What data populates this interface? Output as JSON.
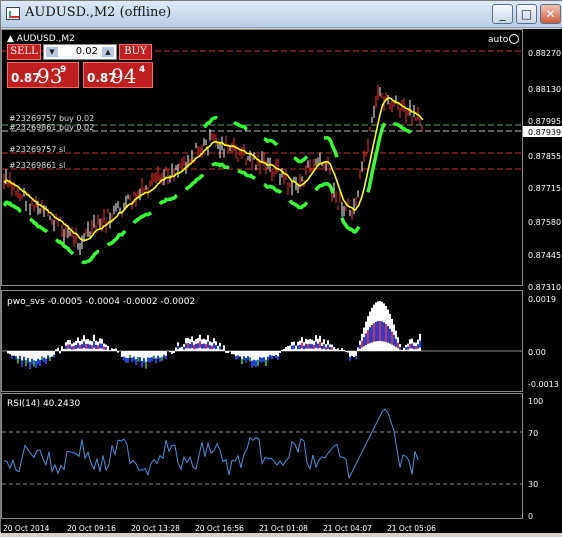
{
  "window": {
    "title": "AUDUSD.,M2 (offline)",
    "min_label": "_",
    "max_label": "□",
    "close_label": "✕"
  },
  "colors": {
    "bg": "#000000",
    "grid": "#5a5a5a",
    "candle": "#ff3030",
    "ema": "#ffff00",
    "band": "#33ff33",
    "rsi": "#4a90e2"
  },
  "main": {
    "symbol_label": "▲ AUDUSD.,M2",
    "auto_label": "auto",
    "order_labels": [
      "#23269757 buy 0.02",
      "#23269861 buy 0.02",
      "#23269757 sl",
      "#23269861 sl"
    ],
    "price_ticks": [
      "0.88270",
      "0.88130",
      "0.87995",
      "0.87855",
      "0.87715",
      "0.87580",
      "0.87445",
      "0.87310"
    ],
    "current_price": "0.87939"
  },
  "trade_panel": {
    "sell_label": "SELL",
    "buy_label": "BUY",
    "lot": "0.02",
    "bid_small": "0.87",
    "bid_big": "93",
    "bid_sup": "9",
    "ask_small": "0.87",
    "ask_big": "94",
    "ask_sup": "4"
  },
  "pwo": {
    "label": "pwo_svs -0.0005 -0.0004 -0.0002 -0.0002",
    "ticks": [
      "0.0019",
      "0.00",
      "-0.0013"
    ]
  },
  "rsi": {
    "label": "RSI(14) 40.2430",
    "ticks": [
      "100",
      "70",
      "30",
      "0"
    ]
  },
  "time_axis": [
    "20 Oct 2014",
    "20 Oct 09:16",
    "20 Oct 13:28",
    "20 Oct 16:56",
    "21 Oct 01:08",
    "21 Oct 04:07",
    "21 Oct 05:06"
  ]
}
